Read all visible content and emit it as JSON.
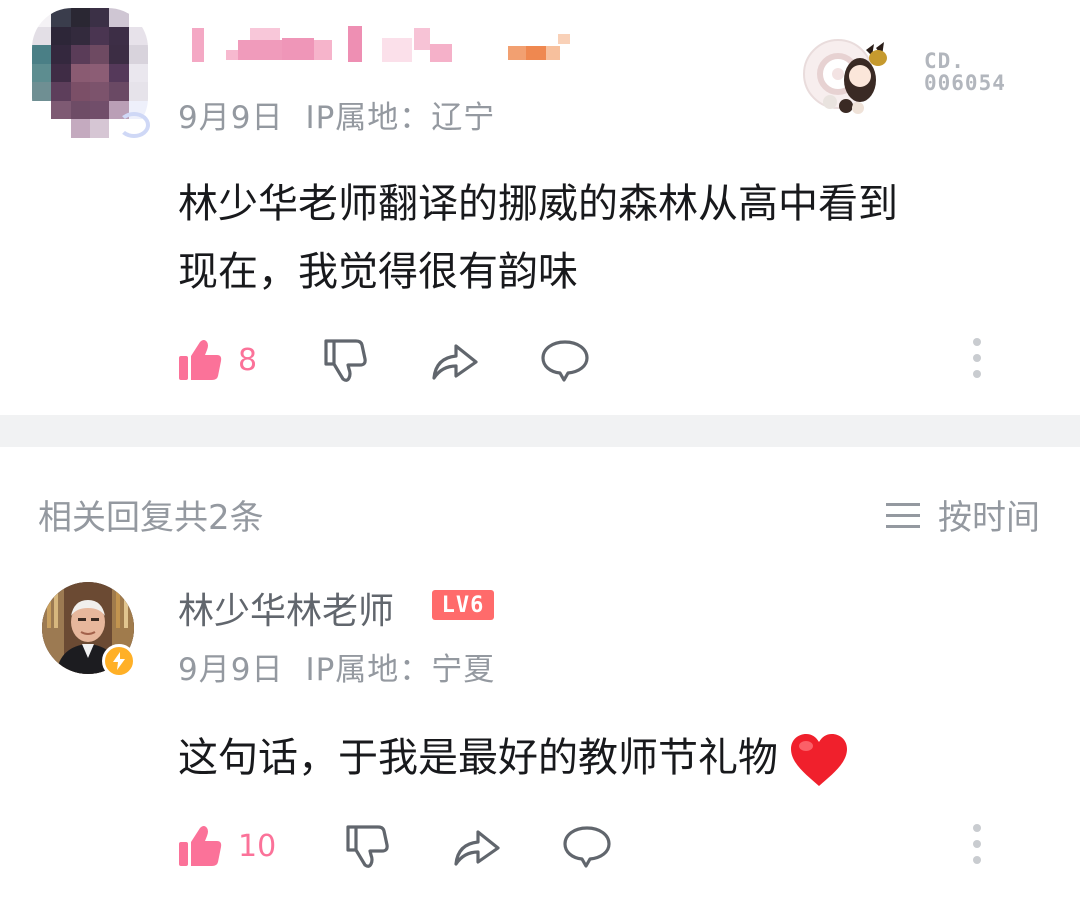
{
  "comment1": {
    "meta": {
      "date": "9月9日",
      "ip_location": "IP属地：辽宁"
    },
    "fan_badge_number_line1": "CD.",
    "fan_badge_number_line2": "006054",
    "content_line1": "林少华老师翻译的挪威的森林从高中看到",
    "content_line2": "现在，我觉得很有韵味",
    "like_count": "8"
  },
  "replies_section": {
    "header": "相关回复共2条",
    "sort_label": "按时间"
  },
  "reply1": {
    "username": "林少华林老师",
    "level_badge": "LV6",
    "meta": {
      "date": "9月9日",
      "ip_location": "IP属地：宁夏"
    },
    "content": "这句话，于我是最好的教师节礼物",
    "like_count": "10"
  },
  "colors": {
    "accent_pink": "#fb7299",
    "meta_gray": "#9499a0",
    "divider": "#f1f2f3",
    "level_badge": "#ff6b6b",
    "verified_badge": "#ffb027"
  },
  "icons": {
    "like": "thumbs-up-icon",
    "dislike": "thumbs-down-icon",
    "share": "share-icon",
    "reply": "comment-bubble-icon",
    "more": "more-vertical-icon",
    "sort": "menu-lines-icon",
    "verified": "lightning-icon",
    "heart": "heart-emoji-icon"
  }
}
